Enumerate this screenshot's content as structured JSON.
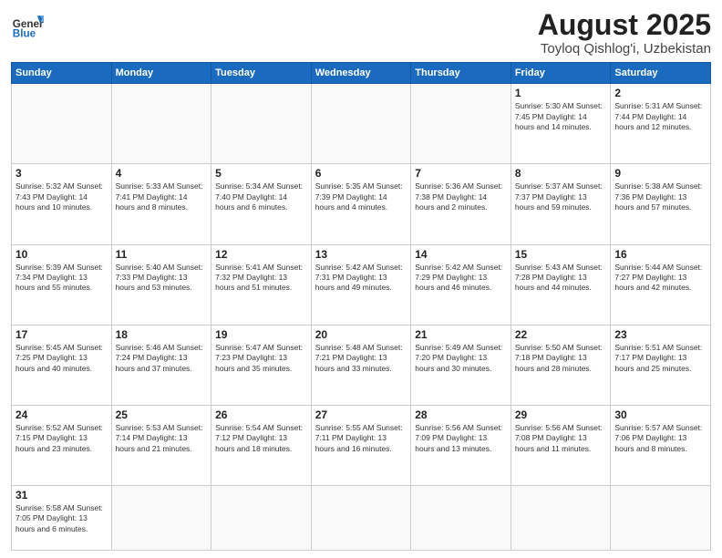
{
  "logo": {
    "text_general": "General",
    "text_blue": "Blue"
  },
  "header": {
    "month": "August 2025",
    "location": "Toyloq Qishlog'i, Uzbekistan"
  },
  "weekdays": [
    "Sunday",
    "Monday",
    "Tuesday",
    "Wednesday",
    "Thursday",
    "Friday",
    "Saturday"
  ],
  "weeks": [
    [
      {
        "day": "",
        "info": ""
      },
      {
        "day": "",
        "info": ""
      },
      {
        "day": "",
        "info": ""
      },
      {
        "day": "",
        "info": ""
      },
      {
        "day": "",
        "info": ""
      },
      {
        "day": "1",
        "info": "Sunrise: 5:30 AM\nSunset: 7:45 PM\nDaylight: 14 hours and 14 minutes."
      },
      {
        "day": "2",
        "info": "Sunrise: 5:31 AM\nSunset: 7:44 PM\nDaylight: 14 hours and 12 minutes."
      }
    ],
    [
      {
        "day": "3",
        "info": "Sunrise: 5:32 AM\nSunset: 7:43 PM\nDaylight: 14 hours and 10 minutes."
      },
      {
        "day": "4",
        "info": "Sunrise: 5:33 AM\nSunset: 7:41 PM\nDaylight: 14 hours and 8 minutes."
      },
      {
        "day": "5",
        "info": "Sunrise: 5:34 AM\nSunset: 7:40 PM\nDaylight: 14 hours and 6 minutes."
      },
      {
        "day": "6",
        "info": "Sunrise: 5:35 AM\nSunset: 7:39 PM\nDaylight: 14 hours and 4 minutes."
      },
      {
        "day": "7",
        "info": "Sunrise: 5:36 AM\nSunset: 7:38 PM\nDaylight: 14 hours and 2 minutes."
      },
      {
        "day": "8",
        "info": "Sunrise: 5:37 AM\nSunset: 7:37 PM\nDaylight: 13 hours and 59 minutes."
      },
      {
        "day": "9",
        "info": "Sunrise: 5:38 AM\nSunset: 7:36 PM\nDaylight: 13 hours and 57 minutes."
      }
    ],
    [
      {
        "day": "10",
        "info": "Sunrise: 5:39 AM\nSunset: 7:34 PM\nDaylight: 13 hours and 55 minutes."
      },
      {
        "day": "11",
        "info": "Sunrise: 5:40 AM\nSunset: 7:33 PM\nDaylight: 13 hours and 53 minutes."
      },
      {
        "day": "12",
        "info": "Sunrise: 5:41 AM\nSunset: 7:32 PM\nDaylight: 13 hours and 51 minutes."
      },
      {
        "day": "13",
        "info": "Sunrise: 5:42 AM\nSunset: 7:31 PM\nDaylight: 13 hours and 49 minutes."
      },
      {
        "day": "14",
        "info": "Sunrise: 5:42 AM\nSunset: 7:29 PM\nDaylight: 13 hours and 46 minutes."
      },
      {
        "day": "15",
        "info": "Sunrise: 5:43 AM\nSunset: 7:28 PM\nDaylight: 13 hours and 44 minutes."
      },
      {
        "day": "16",
        "info": "Sunrise: 5:44 AM\nSunset: 7:27 PM\nDaylight: 13 hours and 42 minutes."
      }
    ],
    [
      {
        "day": "17",
        "info": "Sunrise: 5:45 AM\nSunset: 7:25 PM\nDaylight: 13 hours and 40 minutes."
      },
      {
        "day": "18",
        "info": "Sunrise: 5:46 AM\nSunset: 7:24 PM\nDaylight: 13 hours and 37 minutes."
      },
      {
        "day": "19",
        "info": "Sunrise: 5:47 AM\nSunset: 7:23 PM\nDaylight: 13 hours and 35 minutes."
      },
      {
        "day": "20",
        "info": "Sunrise: 5:48 AM\nSunset: 7:21 PM\nDaylight: 13 hours and 33 minutes."
      },
      {
        "day": "21",
        "info": "Sunrise: 5:49 AM\nSunset: 7:20 PM\nDaylight: 13 hours and 30 minutes."
      },
      {
        "day": "22",
        "info": "Sunrise: 5:50 AM\nSunset: 7:18 PM\nDaylight: 13 hours and 28 minutes."
      },
      {
        "day": "23",
        "info": "Sunrise: 5:51 AM\nSunset: 7:17 PM\nDaylight: 13 hours and 25 minutes."
      }
    ],
    [
      {
        "day": "24",
        "info": "Sunrise: 5:52 AM\nSunset: 7:15 PM\nDaylight: 13 hours and 23 minutes."
      },
      {
        "day": "25",
        "info": "Sunrise: 5:53 AM\nSunset: 7:14 PM\nDaylight: 13 hours and 21 minutes."
      },
      {
        "day": "26",
        "info": "Sunrise: 5:54 AM\nSunset: 7:12 PM\nDaylight: 13 hours and 18 minutes."
      },
      {
        "day": "27",
        "info": "Sunrise: 5:55 AM\nSunset: 7:11 PM\nDaylight: 13 hours and 16 minutes."
      },
      {
        "day": "28",
        "info": "Sunrise: 5:56 AM\nSunset: 7:09 PM\nDaylight: 13 hours and 13 minutes."
      },
      {
        "day": "29",
        "info": "Sunrise: 5:56 AM\nSunset: 7:08 PM\nDaylight: 13 hours and 11 minutes."
      },
      {
        "day": "30",
        "info": "Sunrise: 5:57 AM\nSunset: 7:06 PM\nDaylight: 13 hours and 8 minutes."
      }
    ],
    [
      {
        "day": "31",
        "info": "Sunrise: 5:58 AM\nSunset: 7:05 PM\nDaylight: 13 hours and 6 minutes."
      },
      {
        "day": "",
        "info": ""
      },
      {
        "day": "",
        "info": ""
      },
      {
        "day": "",
        "info": ""
      },
      {
        "day": "",
        "info": ""
      },
      {
        "day": "",
        "info": ""
      },
      {
        "day": "",
        "info": ""
      }
    ]
  ]
}
